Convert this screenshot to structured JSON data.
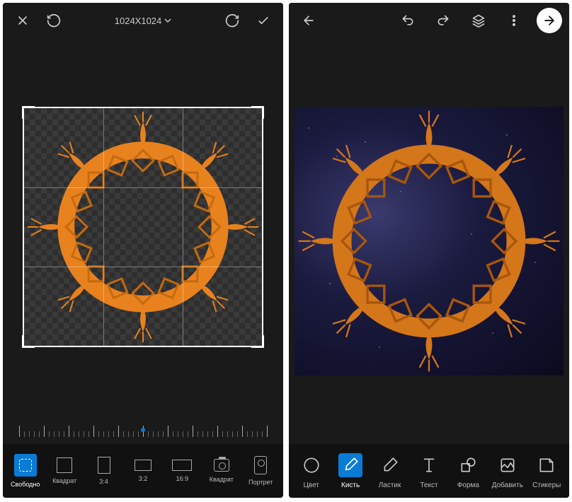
{
  "left": {
    "dimensions": "1024X1024",
    "tools": [
      {
        "id": "free",
        "label": "Свободно"
      },
      {
        "id": "square",
        "label": "Квадрат"
      },
      {
        "id": "r34",
        "label": "3:4"
      },
      {
        "id": "r32",
        "label": "3:2"
      },
      {
        "id": "r169",
        "label": "16:9"
      },
      {
        "id": "camera",
        "label": "Квадрат"
      },
      {
        "id": "portrait",
        "label": "Портрет"
      }
    ],
    "activeTool": "free"
  },
  "right": {
    "tools": [
      {
        "id": "color",
        "label": "Цвет"
      },
      {
        "id": "brush",
        "label": "Кисть"
      },
      {
        "id": "eraser",
        "label": "Ластик"
      },
      {
        "id": "text",
        "label": "Текст"
      },
      {
        "id": "shape",
        "label": "Форма"
      },
      {
        "id": "add",
        "label": "Добавить"
      },
      {
        "id": "stickers",
        "label": "Стикеры"
      }
    ],
    "activeTool": "brush"
  },
  "colors": {
    "accent": "#0b7cd6",
    "mandala": "#e8821e"
  }
}
